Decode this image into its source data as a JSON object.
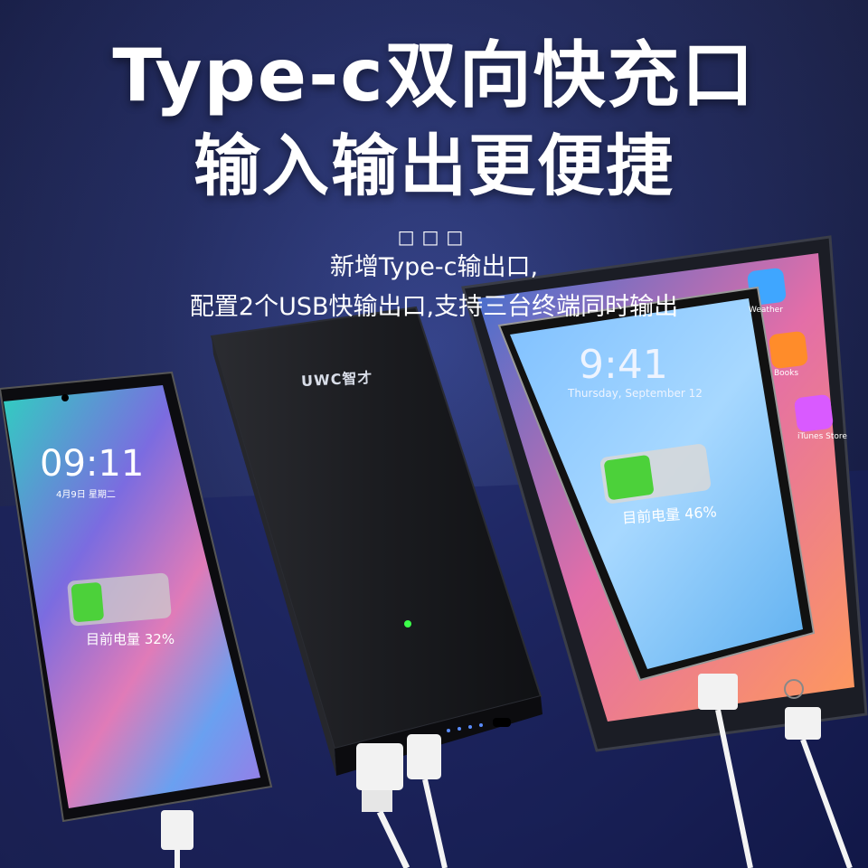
{
  "headline": {
    "line1": "Type-c双向快充口",
    "line2": "输入输出更便捷"
  },
  "divider_dots": "□□□",
  "subtitle": {
    "line1": "新增Type-c输出口,",
    "line2": "配置2个USB快输出口,支持三台终端同时输出"
  },
  "power_bank": {
    "logo_text": "UWC智才",
    "led_color": "#3cff4a"
  },
  "phone_left": {
    "time": "09:11",
    "date": "4月9日 星期二",
    "battery_text": "目前电量 32%",
    "battery_level": 0.32
  },
  "phone_right": {
    "time": "9:41",
    "date": "Thursday, September 12",
    "battery_text": "目前电量 46%",
    "battery_level": 0.46
  },
  "tablet": {
    "app_labels": [
      "Weather",
      "Books",
      "iTunes Store"
    ]
  },
  "colors": {
    "background_dark": "#0b1035",
    "background_light": "#2a3a8a",
    "battery_green": "#4cd13a",
    "power_bank_body": "#1b1c20"
  }
}
